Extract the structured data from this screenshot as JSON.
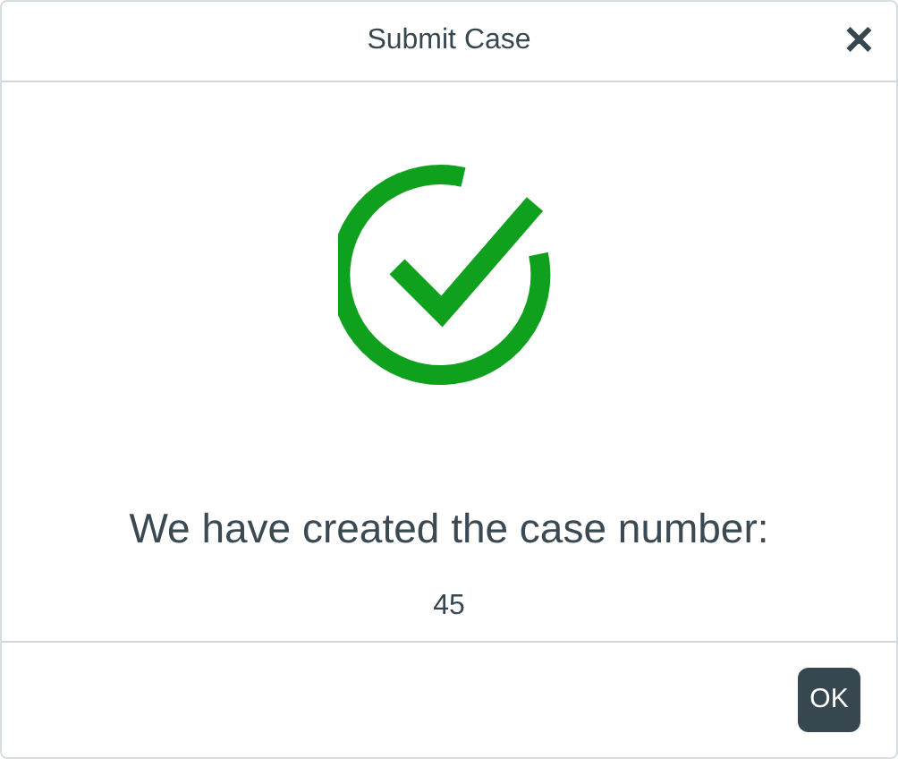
{
  "dialog": {
    "title": "Submit Case",
    "close": "✕"
  },
  "message": "We have created the case number:",
  "case_number": "45",
  "buttons": [
    "OK"
  ]
}
